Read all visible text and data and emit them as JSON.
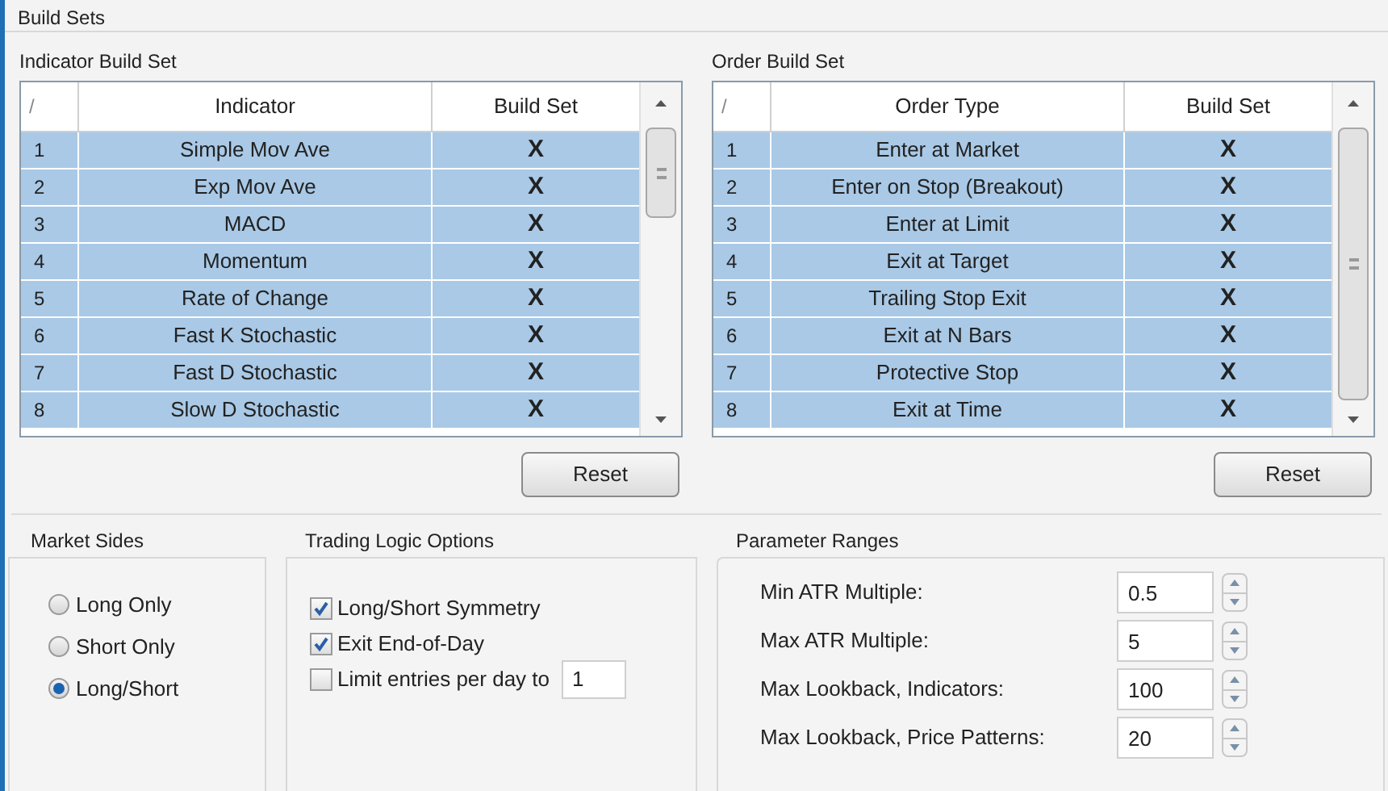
{
  "group_title": "Build Sets",
  "tables": [
    {
      "title": "Indicator Build Set",
      "columns": [
        "/",
        "Indicator",
        "Build Set"
      ],
      "rows": [
        {
          "number": "1",
          "name": "Simple Mov Ave",
          "build_set": "X",
          "selected": true
        },
        {
          "number": "2",
          "name": "Exp Mov Ave",
          "build_set": "X",
          "selected": true
        },
        {
          "number": "3",
          "name": "MACD",
          "build_set": "X",
          "selected": true
        },
        {
          "number": "4",
          "name": "Momentum",
          "build_set": "X",
          "selected": true
        },
        {
          "number": "5",
          "name": "Rate of Change",
          "build_set": "X",
          "selected": true
        },
        {
          "number": "6",
          "name": "Fast K Stochastic",
          "build_set": "X",
          "selected": true
        },
        {
          "number": "7",
          "name": "Fast D Stochastic",
          "build_set": "X",
          "selected": true
        },
        {
          "number": "8",
          "name": "Slow D Stochastic",
          "build_set": "X",
          "selected": true
        }
      ],
      "reset": "Reset"
    },
    {
      "title": "Order Build Set",
      "columns": [
        "/",
        "Order Type",
        "Build Set"
      ],
      "rows": [
        {
          "number": "1",
          "name": "Enter at Market",
          "build_set": "X",
          "selected": true
        },
        {
          "number": "2",
          "name": "Enter on Stop (Breakout)",
          "build_set": "X",
          "selected": true
        },
        {
          "number": "3",
          "name": "Enter at Limit",
          "build_set": "X",
          "selected": true
        },
        {
          "number": "4",
          "name": "Exit at Target",
          "build_set": "X",
          "selected": true
        },
        {
          "number": "5",
          "name": "Trailing Stop Exit",
          "build_set": "X",
          "selected": true
        },
        {
          "number": "6",
          "name": "Exit at N Bars",
          "build_set": "X",
          "selected": true
        },
        {
          "number": "7",
          "name": "Protective Stop",
          "build_set": "X",
          "selected": true
        },
        {
          "number": "8",
          "name": "Exit at Time",
          "build_set": "X",
          "selected": true
        }
      ],
      "reset": "Reset"
    }
  ],
  "market_sides": {
    "title": "Market Sides",
    "options": [
      {
        "label": "Long Only",
        "selected": false
      },
      {
        "label": "Short Only",
        "selected": false
      },
      {
        "label": "Long/Short",
        "selected": true
      }
    ]
  },
  "trading_logic": {
    "title": "Trading Logic Options",
    "options": [
      {
        "label": "Long/Short Symmetry",
        "checked": true
      },
      {
        "label": "Exit End-of-Day",
        "checked": true
      },
      {
        "label": "Limit entries per day to",
        "checked": false,
        "value": "1"
      }
    ]
  },
  "parameter_ranges": {
    "title": "Parameter Ranges",
    "fields": [
      {
        "label": "Min ATR Multiple:",
        "value": "0.5"
      },
      {
        "label": "Max ATR Multiple:",
        "value": "5"
      },
      {
        "label": "Max Lookback, Indicators:",
        "value": "100"
      },
      {
        "label": "Max Lookback, Price Patterns:",
        "value": "20"
      }
    ]
  }
}
